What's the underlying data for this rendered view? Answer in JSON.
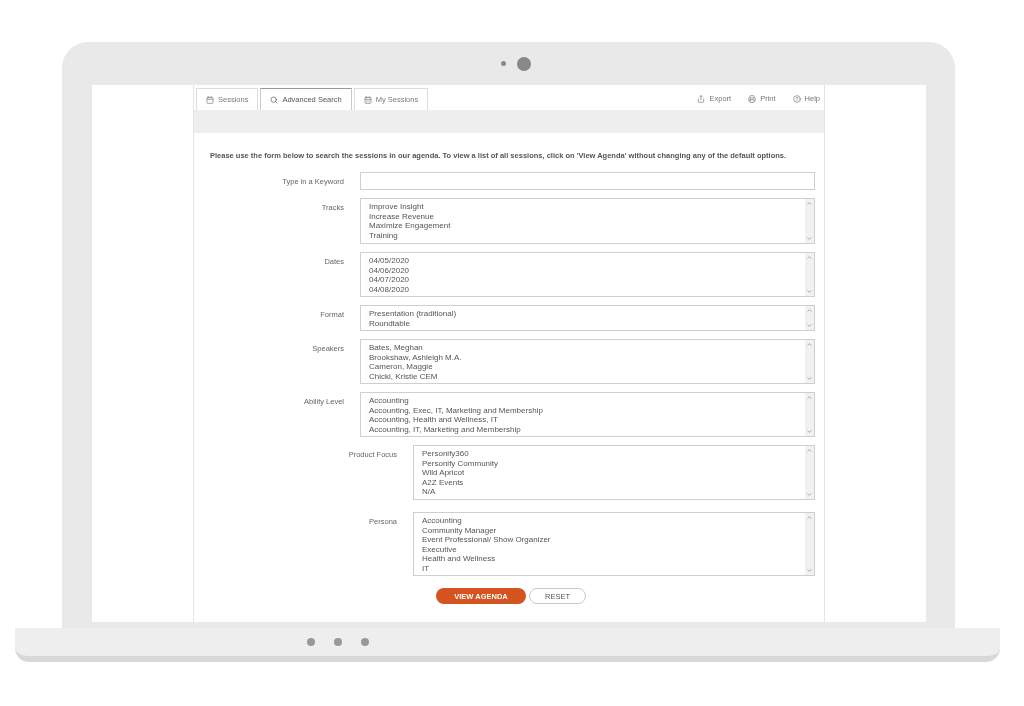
{
  "tabs": [
    {
      "label": "Sessions",
      "selected": false
    },
    {
      "label": "Advanced Search",
      "selected": true
    },
    {
      "label": "My Sessions",
      "selected": false
    }
  ],
  "actions": [
    {
      "label": "Export"
    },
    {
      "label": "Print"
    },
    {
      "label": "Help"
    }
  ],
  "intro": "Please use the form below to search the sessions in our agenda. To view a list of all sessions, click on 'View Agenda' without changing any of the default options.",
  "keyword": {
    "label": "Type in a Keyword"
  },
  "filters": [
    {
      "label": "Tracks",
      "kind": "main",
      "options": [
        "Improve Insight",
        "Increase Revenue",
        "Maximize Engagement",
        "Training"
      ]
    },
    {
      "label": "Dates",
      "kind": "main",
      "options": [
        "04/05/2020",
        "04/06/2020",
        "04/07/2020",
        "04/08/2020"
      ]
    },
    {
      "label": "Format",
      "kind": "main",
      "options": [
        "Presentation (traditional)",
        "Roundtable"
      ]
    },
    {
      "label": "Speakers",
      "kind": "main",
      "options": [
        "Bates, Meghan",
        "Brookshaw, Ashleigh M.A.",
        "Cameron, Maggie",
        "Chicki, Kristie CEM"
      ]
    },
    {
      "label": "Ability Level",
      "kind": "main",
      "options": [
        "Accounting",
        "Accounting, Exec, IT, Marketing and Membership",
        "Accounting, Health and Wellness, IT",
        "Accounting, IT, Marketing and Membership"
      ]
    },
    {
      "label": "Product Focus",
      "kind": "inset",
      "options": [
        "Personify360",
        "Personify Community",
        "Wild Apricot",
        "A2Z Events",
        "N/A"
      ]
    },
    {
      "label": "Persona",
      "kind": "inset",
      "options": [
        "Accounting",
        "Community Manager",
        "Event Professional/ Show Organizer",
        "Executive",
        "Health and Wellness",
        "IT"
      ]
    }
  ],
  "buttons": [
    {
      "label": "VIEW AGENDA",
      "kind": "primary"
    },
    {
      "label": "RESET",
      "kind": "secondary"
    }
  ]
}
